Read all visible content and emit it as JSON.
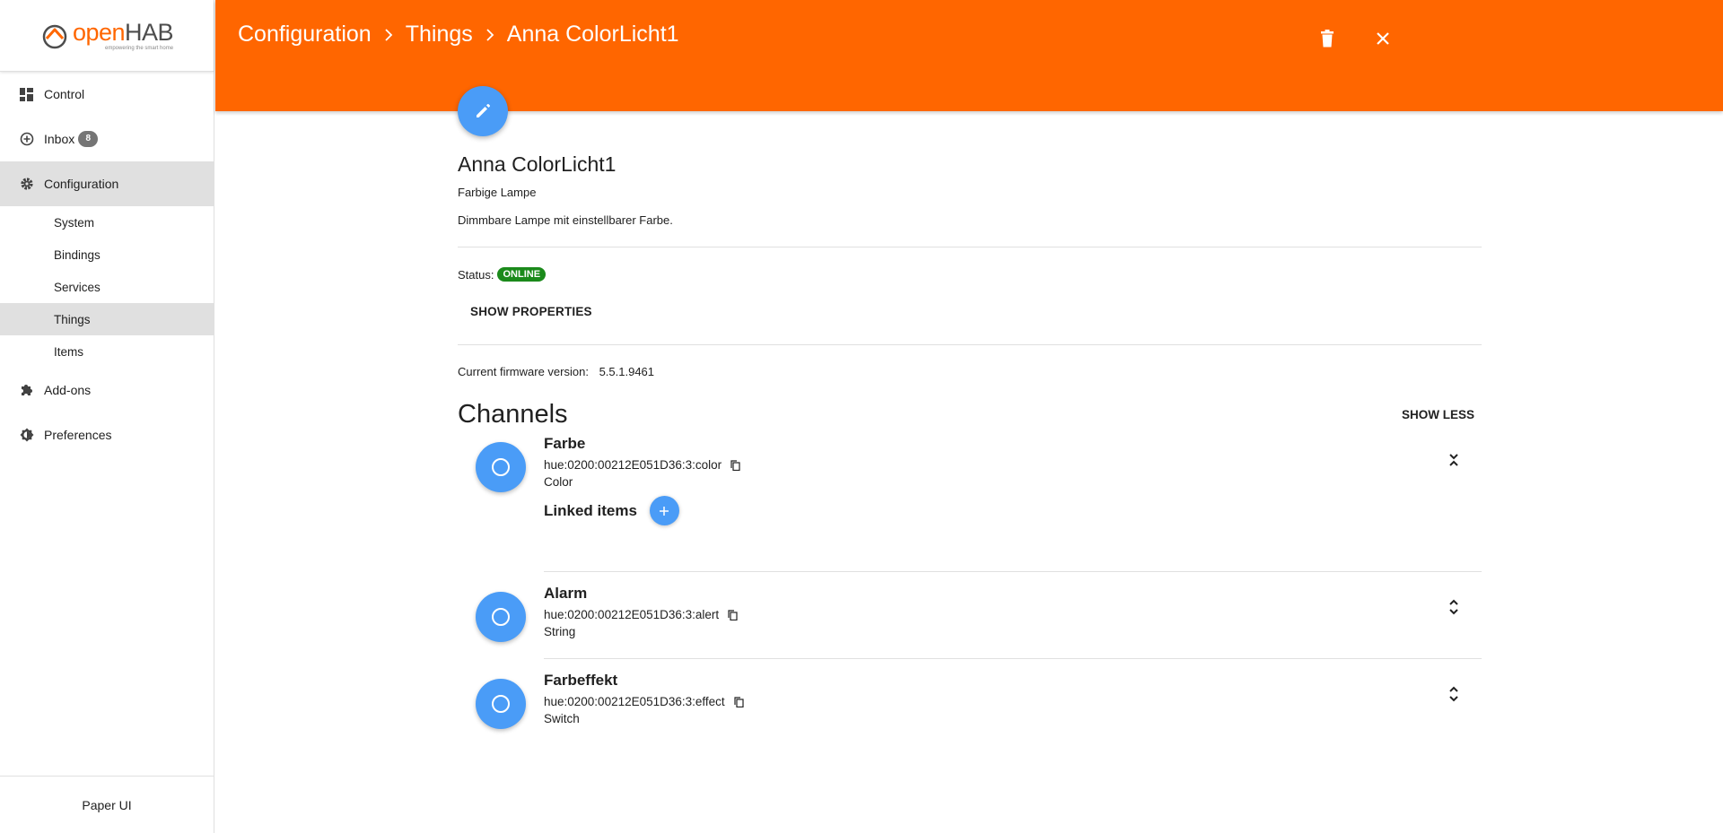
{
  "app": {
    "logo_open": "open",
    "logo_hab": "HAB",
    "logo_tagline": "empowering the smart home",
    "footer": "Paper UI"
  },
  "sidebar": {
    "control": "Control",
    "inbox": "Inbox",
    "inbox_count": "8",
    "configuration": "Configuration",
    "sub": {
      "system": "System",
      "bindings": "Bindings",
      "services": "Services",
      "things": "Things",
      "items": "Items"
    },
    "addons": "Add-ons",
    "preferences": "Preferences"
  },
  "header": {
    "crumbs": [
      "Configuration",
      "Things",
      "Anna ColorLicht1"
    ],
    "separator": ">"
  },
  "thing": {
    "title": "Anna ColorLicht1",
    "type": "Farbige Lampe",
    "description": "Dimmbare Lampe mit einstellbarer Farbe.",
    "status_label": "Status:",
    "status": "ONLINE",
    "show_properties": "SHOW PROPERTIES",
    "firmware_label": "Current firmware version:",
    "firmware_value": "5.5.1.9461"
  },
  "channels": {
    "title": "Channels",
    "toggle": "SHOW LESS",
    "linked_items_label": "Linked items",
    "list": [
      {
        "name": "Farbe",
        "uid": "hue:0200:00212E051D36:3:color",
        "type": "Color"
      },
      {
        "name": "Alarm",
        "uid": "hue:0200:00212E051D36:3:alert",
        "type": "String"
      },
      {
        "name": "Farbeffekt",
        "uid": "hue:0200:00212E051D36:3:effect",
        "type": "Switch"
      }
    ]
  },
  "colors": {
    "accent": "#ff6600",
    "primary": "#4a9cf7",
    "online": "#1b8a1b"
  },
  "icons": {
    "control": "dashboard-icon",
    "inbox": "add-circle-icon",
    "configuration": "gear-icon",
    "addons": "puzzle-icon",
    "preferences": "brightness-icon",
    "delete": "trash-icon",
    "close": "close-icon",
    "edit": "pencil-icon",
    "copy": "copy-icon",
    "expand": "unfold-icon"
  }
}
